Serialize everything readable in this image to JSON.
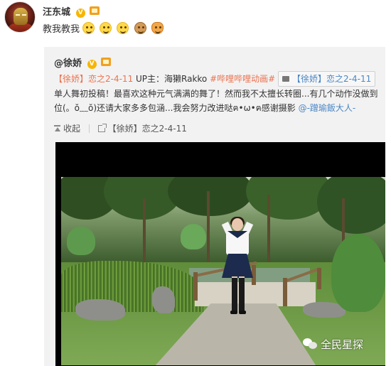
{
  "post": {
    "author": "汪东城",
    "text": "教我教我",
    "emojis": [
      "crying-laugh-emoji",
      "crying-laugh-emoji",
      "laughing-emoji",
      "dog-face-emoji",
      "cat-face-emoji"
    ]
  },
  "repost": {
    "author": "@徐娇",
    "text_parts": {
      "video_tag": "【徐娇】恋之2-4-11",
      "up_label": " UP主：海獭Rakko ",
      "channel_tag": "#哔哩哔哩动画#",
      "chip_label": "【徐娇】恋之2-4-11",
      "body": " 单人舞初投稿！最喜欢这种元气满满的舞了！然而我不太擅长转圈...有几个动作没做到位(。ŏ﹏ŏ)还请大家多多包涵...我会努力改进哒ฅ•ω•ฅ感谢摄影 ",
      "mention": "@-蹭瑜飯大人-"
    },
    "actions": {
      "collapse_label": "收起",
      "video_link_label": "【徐娇】恋之2-4-11"
    }
  },
  "watermark": {
    "text": "全民星探"
  }
}
